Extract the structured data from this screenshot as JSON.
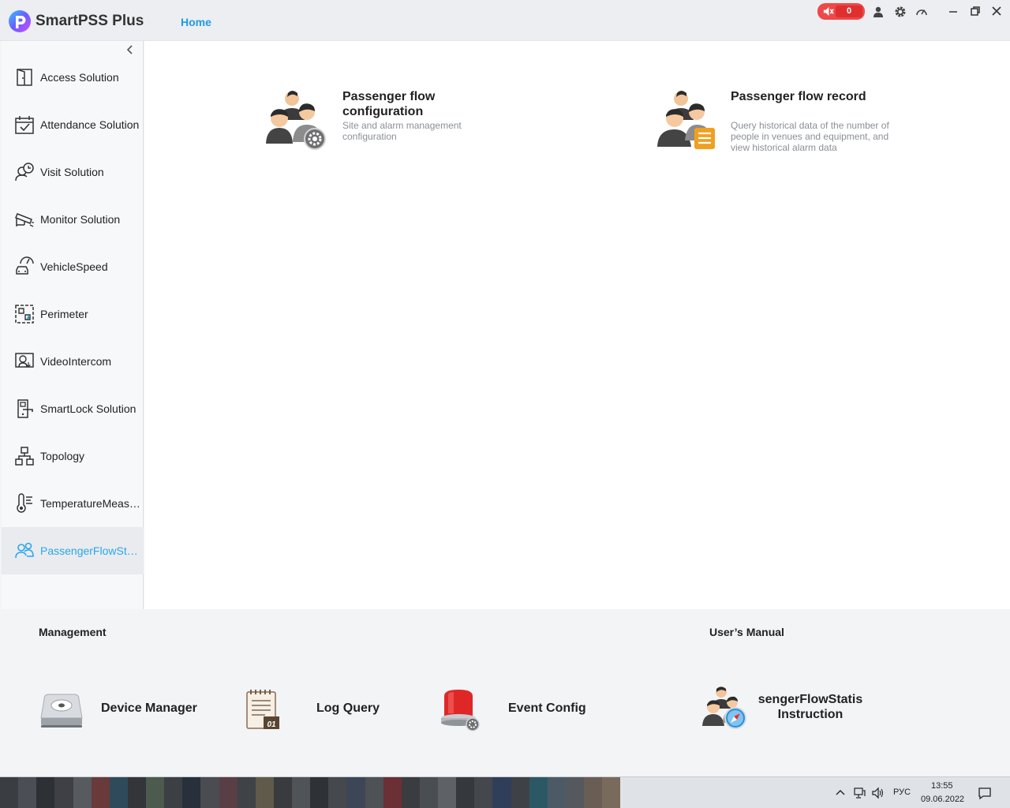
{
  "app": {
    "title": "SmartPSS Plus",
    "home_tab": "Home",
    "alarm_count": "0",
    "accent": "#1e9be6",
    "alarm_color": "#ee4848"
  },
  "sidebar": {
    "items": [
      {
        "label": "Access Solution",
        "icon": "door-icon"
      },
      {
        "label": "Attendance Solution",
        "icon": "calendar-check-icon"
      },
      {
        "label": "Visit Solution",
        "icon": "visitor-clock-icon"
      },
      {
        "label": "Monitor Solution",
        "icon": "camera-icon"
      },
      {
        "label": "VehicleSpeed",
        "icon": "vehicle-speed-icon"
      },
      {
        "label": "Perimeter",
        "icon": "perimeter-icon"
      },
      {
        "label": "VideoIntercom",
        "icon": "intercom-icon"
      },
      {
        "label": "SmartLock Solution",
        "icon": "smart-lock-icon"
      },
      {
        "label": "Topology",
        "icon": "topology-icon"
      },
      {
        "label": "TemperatureMeasurement",
        "icon": "thermometer-icon"
      },
      {
        "label": "PassengerFlowStatistics",
        "icon": "people-icon",
        "active": true
      }
    ]
  },
  "main": {
    "cards": [
      {
        "title": "Passenger flow configuration",
        "desc": "Site and alarm management configuration"
      },
      {
        "title": "Passenger flow record",
        "desc": "Query historical data of the number of people in venues and equipment, and view historical alarm data"
      }
    ]
  },
  "bottom": {
    "management_title": "Management",
    "manual_title": "User’s Manual",
    "tools": [
      {
        "label": "Device Manager",
        "icon": "device-manager-icon"
      },
      {
        "label": "Log Query",
        "icon": "log-query-icon"
      },
      {
        "label": "Event Config",
        "icon": "event-config-icon"
      }
    ],
    "manual": {
      "line1": "sengerFlowStatis",
      "line2": "Instruction"
    }
  },
  "taskbar": {
    "lang": "РУС",
    "time": "13:55",
    "date": "09.06.2022"
  }
}
